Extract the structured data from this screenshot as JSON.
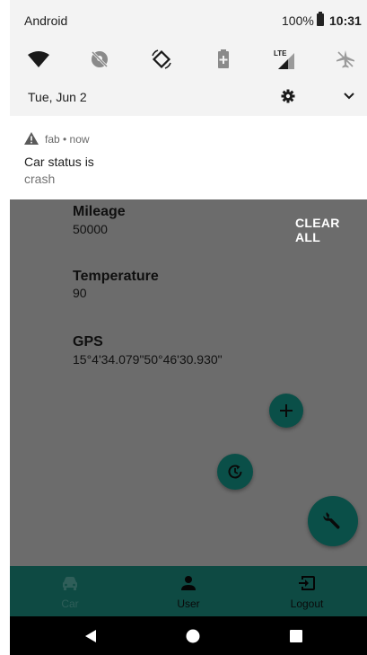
{
  "status_bar": {
    "carrier": "Android",
    "battery_percent": "100%",
    "time": "10:31"
  },
  "quick_settings": {
    "tiles": [
      "wifi-icon",
      "location-off-icon",
      "auto-rotate-icon",
      "battery-saver-icon",
      "lte-signal-icon",
      "airplane-mode-icon"
    ],
    "date": "Tue, Jun 2"
  },
  "notification": {
    "app": "fab • now",
    "title": "Car status is",
    "body": "crash"
  },
  "app": {
    "clear_all": "CLEAR ALL",
    "fields": [
      {
        "label": "Mileage",
        "value": "50000"
      },
      {
        "label": "Temperature",
        "value": "90"
      },
      {
        "label": "GPS",
        "value": "15°4'34.079\"50°46'30.930\""
      }
    ],
    "accent_color": "#0e4a43"
  },
  "bottom_nav": {
    "items": [
      {
        "label": "Car",
        "icon": "car-icon"
      },
      {
        "label": "User",
        "icon": "user-icon"
      },
      {
        "label": "Logout",
        "icon": "logout-icon"
      }
    ]
  }
}
